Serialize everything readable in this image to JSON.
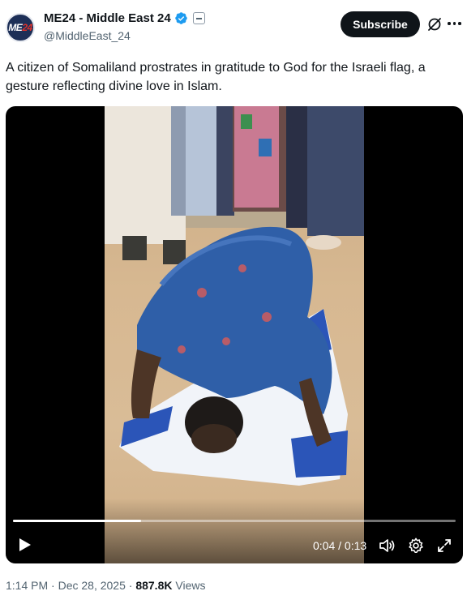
{
  "author": {
    "display_name": "ME24 - Middle East 24",
    "handle": "@MiddleEast_24",
    "avatar_text": "ME",
    "avatar_accent_text": "24",
    "verified_icon": "verified-badge-icon",
    "affiliation_icon": "affiliate-badge-icon"
  },
  "actions": {
    "subscribe_label": "Subscribe",
    "grok_icon": "grok-icon",
    "more_icon": "more-options-icon"
  },
  "post": {
    "text": "A citizen of Somaliland prostrates in gratitude to God for the Israeli flag, a gesture reflecting divine love in Islam."
  },
  "video": {
    "current_time": "0:04",
    "duration": "0:13",
    "time_display": "0:04 / 0:13",
    "progress_fraction": 0.29,
    "controls": {
      "play_icon": "play-icon",
      "volume_icon": "volume-icon",
      "settings_icon": "settings-gear-icon",
      "fullscreen_icon": "fullscreen-icon"
    }
  },
  "meta": {
    "timestamp": "1:14 PM · Dec 28, 2025",
    "separator": "·",
    "views_count": "887.8K",
    "views_label": "Views"
  },
  "colors": {
    "text_primary": "#0f1419",
    "text_secondary": "#536471",
    "verified_blue": "#1d9bf0",
    "flag_blue": "#1f4fb5"
  }
}
